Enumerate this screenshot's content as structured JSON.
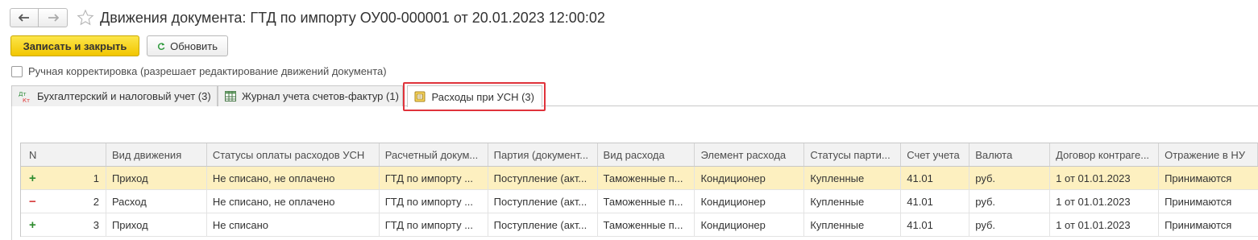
{
  "window": {
    "title": "Движения документа: ГТД по импорту ОУ00-000001 от 20.01.2023 12:00:02"
  },
  "toolbar": {
    "save_close_label": "Записать и закрыть",
    "refresh_label": "Обновить"
  },
  "manual_edit": {
    "label": "Ручная корректировка (разрешает редактирование движений документа)",
    "checked": false
  },
  "tabs": [
    {
      "label": "Бухгалтерский и налоговый учет (3)",
      "icon": "dt-kt-icon"
    },
    {
      "label": "Журнал учета счетов-фактур (1)",
      "icon": "table-icon"
    },
    {
      "label": "Расходы при УСН (3)",
      "icon": "register-icon",
      "active": true
    }
  ],
  "grid": {
    "columns": [
      "N",
      "Вид движения",
      "Статусы оплаты расходов УСН",
      "Расчетный докум...",
      "Партия (документ...",
      "Вид расхода",
      "Элемент расхода",
      "Статусы парти...",
      "Счет учета",
      "Валюта",
      "Договор контраге...",
      "Отражение в НУ"
    ],
    "rows": [
      {
        "sign": "+",
        "n": "1",
        "movement": "Приход",
        "payment_status": "Не списано, не оплачено",
        "settlement_doc": "ГТД по импорту ...",
        "batch": "Поступление (акт...",
        "expense_type": "Таможенные п...",
        "expense_item": "Кондиционер",
        "batch_status": "Купленные",
        "account": "41.01",
        "currency": "руб.",
        "contract": "1 от 01.01.2023",
        "nu": "Принимаются",
        "selected": true
      },
      {
        "sign": "−",
        "n": "2",
        "movement": "Расход",
        "payment_status": "Не списано, не оплачено",
        "settlement_doc": "ГТД по импорту ...",
        "batch": "Поступление (акт...",
        "expense_type": "Таможенные п...",
        "expense_item": "Кондиционер",
        "batch_status": "Купленные",
        "account": "41.01",
        "currency": "руб.",
        "contract": "1 от 01.01.2023",
        "nu": "Принимаются"
      },
      {
        "sign": "+",
        "n": "3",
        "movement": "Приход",
        "payment_status": "Не списано",
        "settlement_doc": "ГТД по импорту ...",
        "batch": "Поступление (акт...",
        "expense_type": "Таможенные п...",
        "expense_item": "Кондиционер",
        "batch_status": "Купленные",
        "account": "41.01",
        "currency": "руб.",
        "contract": "1 от 01.01.2023",
        "nu": "Принимаются"
      }
    ]
  },
  "colors": {
    "primary_button": "#f2c600",
    "highlight": "#e0333b",
    "selected_row": "#fdf0c0",
    "plus_sign": "#2d8b2d",
    "minus_sign": "#d63a3a"
  }
}
